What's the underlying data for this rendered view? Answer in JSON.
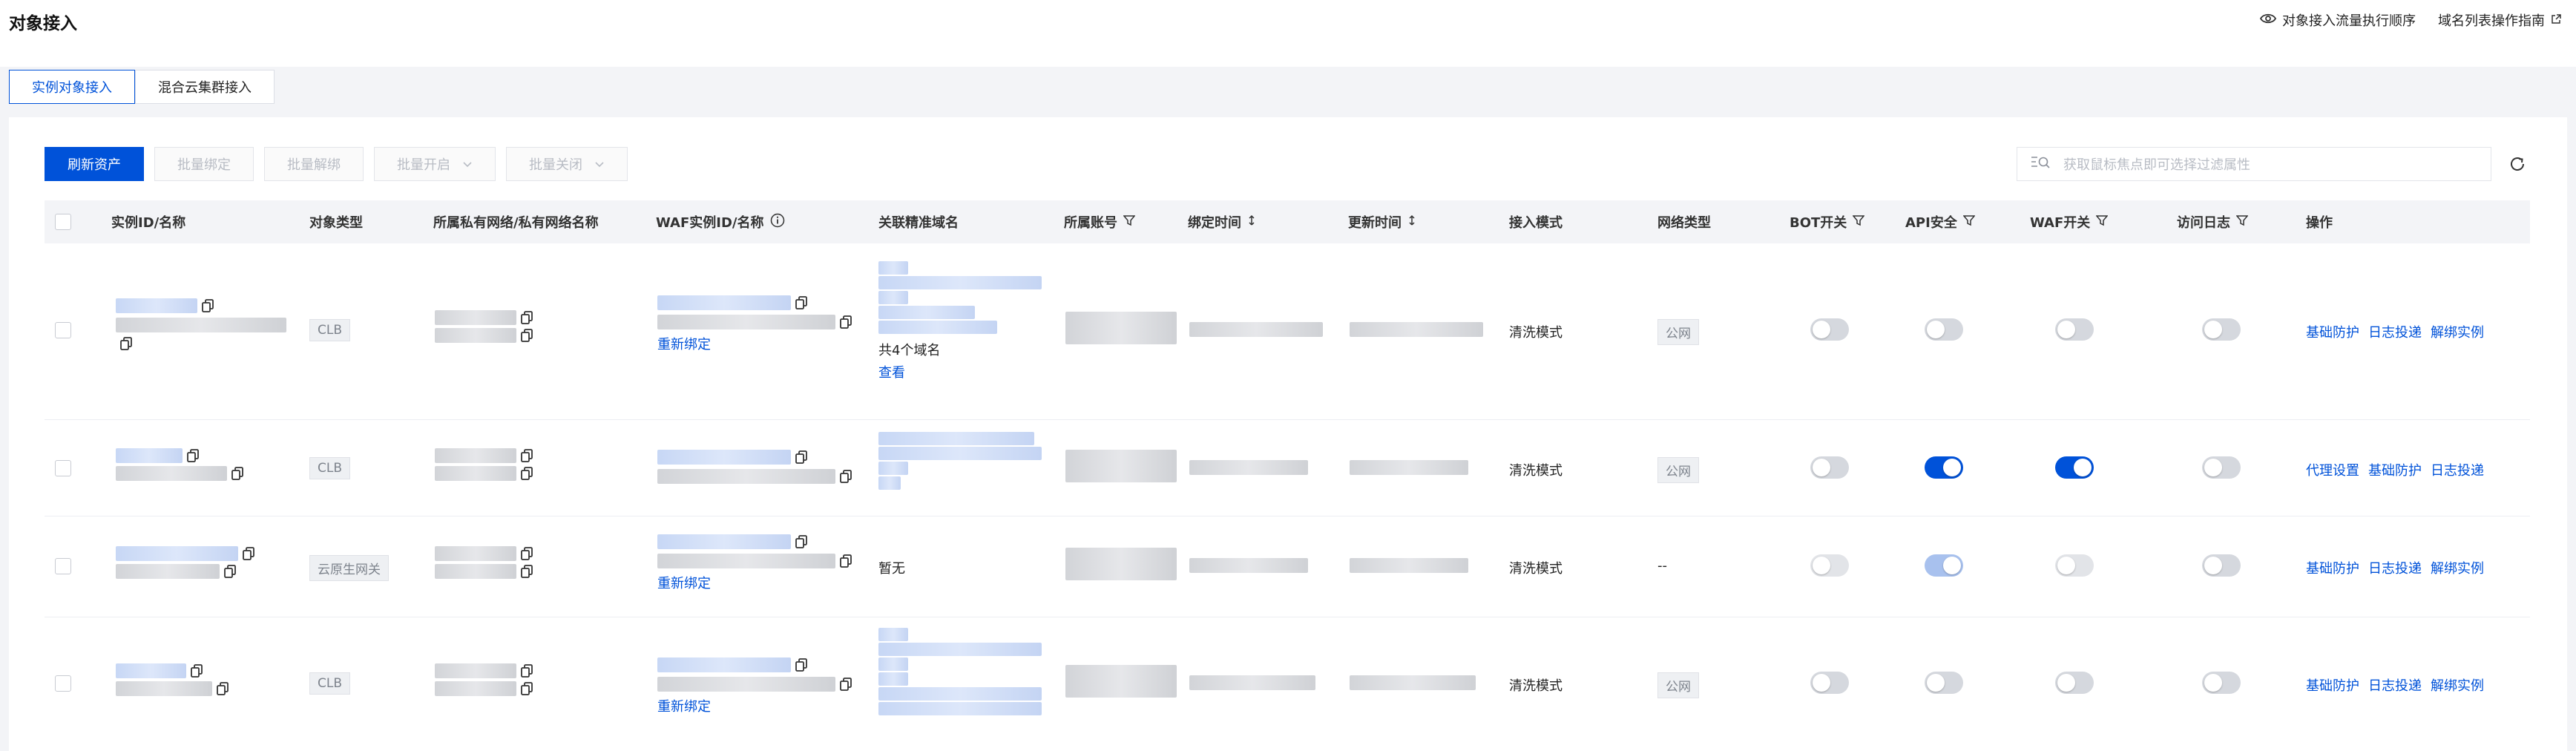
{
  "page": {
    "title": "对象接入"
  },
  "top_links": [
    {
      "label": "对象接入流量执行顺序",
      "icon": "eye-icon"
    },
    {
      "label": "域名列表操作指南",
      "icon": "external-link-icon"
    }
  ],
  "tabs": [
    {
      "label": "实例对象接入",
      "active": true
    },
    {
      "label": "混合云集群接入",
      "active": false
    }
  ],
  "toolbar": {
    "refresh_assets": "刷新资产",
    "batch_bind": "批量绑定",
    "batch_unbind": "批量解绑",
    "batch_enable": "批量开启",
    "batch_disable": "批量关闭"
  },
  "search": {
    "placeholder": "获取鼠标焦点即可选择过滤属性"
  },
  "table": {
    "headers": {
      "instance": "实例ID/名称",
      "object_type": "对象类型",
      "vpc": "所属私有网络/私有网络名称",
      "waf_instance": "WAF实例ID/名称",
      "domain": "关联精准域名",
      "account": "所属账号",
      "bind_time": "绑定时间",
      "update_time": "更新时间",
      "mode": "接入模式",
      "network": "网络类型",
      "bot": "BOT开关",
      "api": "API安全",
      "waf": "WAF开关",
      "log": "访问日志",
      "ops": "操作"
    },
    "rows": [
      {
        "type": "CLB",
        "rebind": "重新绑定",
        "domain_count": "共4个域名",
        "domain_view": "查看",
        "mode": "清洗模式",
        "network": "公网",
        "bot": false,
        "api": false,
        "waf": false,
        "log": false,
        "ops": [
          "基础防护",
          "日志投递",
          "解绑实例"
        ]
      },
      {
        "type": "CLB",
        "mode": "清洗模式",
        "network": "公网",
        "bot": false,
        "api": true,
        "waf": true,
        "log": false,
        "ops": [
          "代理设置",
          "基础防护",
          "日志投递"
        ]
      },
      {
        "type": "云原生网关",
        "rebind": "重新绑定",
        "domain_none": "暂无",
        "mode": "清洗模式",
        "network": "--",
        "bot": false,
        "api": true,
        "waf": false,
        "log": false,
        "ops": [
          "基础防护",
          "日志投递",
          "解绑实例"
        ]
      },
      {
        "type": "CLB",
        "rebind": "重新绑定",
        "mode": "清洗模式",
        "network": "公网",
        "bot": false,
        "api": false,
        "waf": false,
        "log": false,
        "ops": [
          "基础防护",
          "日志投递",
          "解绑实例"
        ]
      }
    ]
  },
  "colors": {
    "primary": "#0052d9",
    "header_bg": "#f3f4f7"
  }
}
